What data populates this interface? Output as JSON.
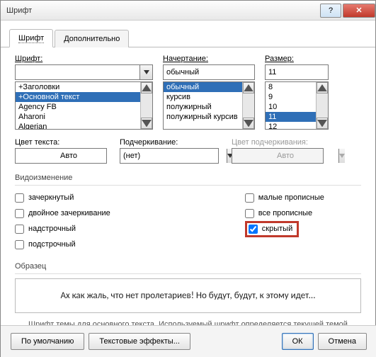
{
  "window": {
    "title": "Шрифт"
  },
  "tabs": {
    "font": "Шрифт",
    "advanced": "Дополнительно"
  },
  "font_section": {
    "label": "Шрифт:",
    "value": "+Основной текст",
    "options": [
      "+Заголовки",
      "+Основной текст",
      "Agency FB",
      "Aharoni",
      "Algerian"
    ],
    "selected_index": 1
  },
  "style_section": {
    "label": "Начертание:",
    "value": "обычный",
    "options": [
      "обычный",
      "курсив",
      "полужирный",
      "полужирный курсив"
    ],
    "selected_index": 0
  },
  "size_section": {
    "label": "Размер:",
    "value": "11",
    "options": [
      "8",
      "9",
      "10",
      "11",
      "12"
    ],
    "selected_index": 3
  },
  "color": {
    "label": "Цвет текста:",
    "value": "Авто"
  },
  "underline": {
    "label": "Подчеркивание:",
    "value": "(нет)"
  },
  "underline_color": {
    "label": "Цвет подчеркивания:",
    "value": "Авто"
  },
  "effects": {
    "section": "Видоизменение",
    "strike": "зачеркнутый",
    "dbl_strike": "двойное зачеркивание",
    "superscript": "надстрочный",
    "subscript": "подстрочный",
    "smallcaps": "малые прописные",
    "allcaps": "все прописные",
    "hidden": "скрытый"
  },
  "sample": {
    "label": "Образец",
    "text": "Ах  как  жаль,  что нет пролетариев! Но будут, будут, к этому идет..."
  },
  "hint": "Шрифт темы для основного текста. Используемый шрифт определяется текущей темой документа.",
  "buttons": {
    "default": "По умолчанию",
    "text_effects": "Текстовые эффекты...",
    "ok": "ОК",
    "cancel": "Отмена"
  },
  "icons": {
    "help": "?",
    "close": "✕"
  }
}
